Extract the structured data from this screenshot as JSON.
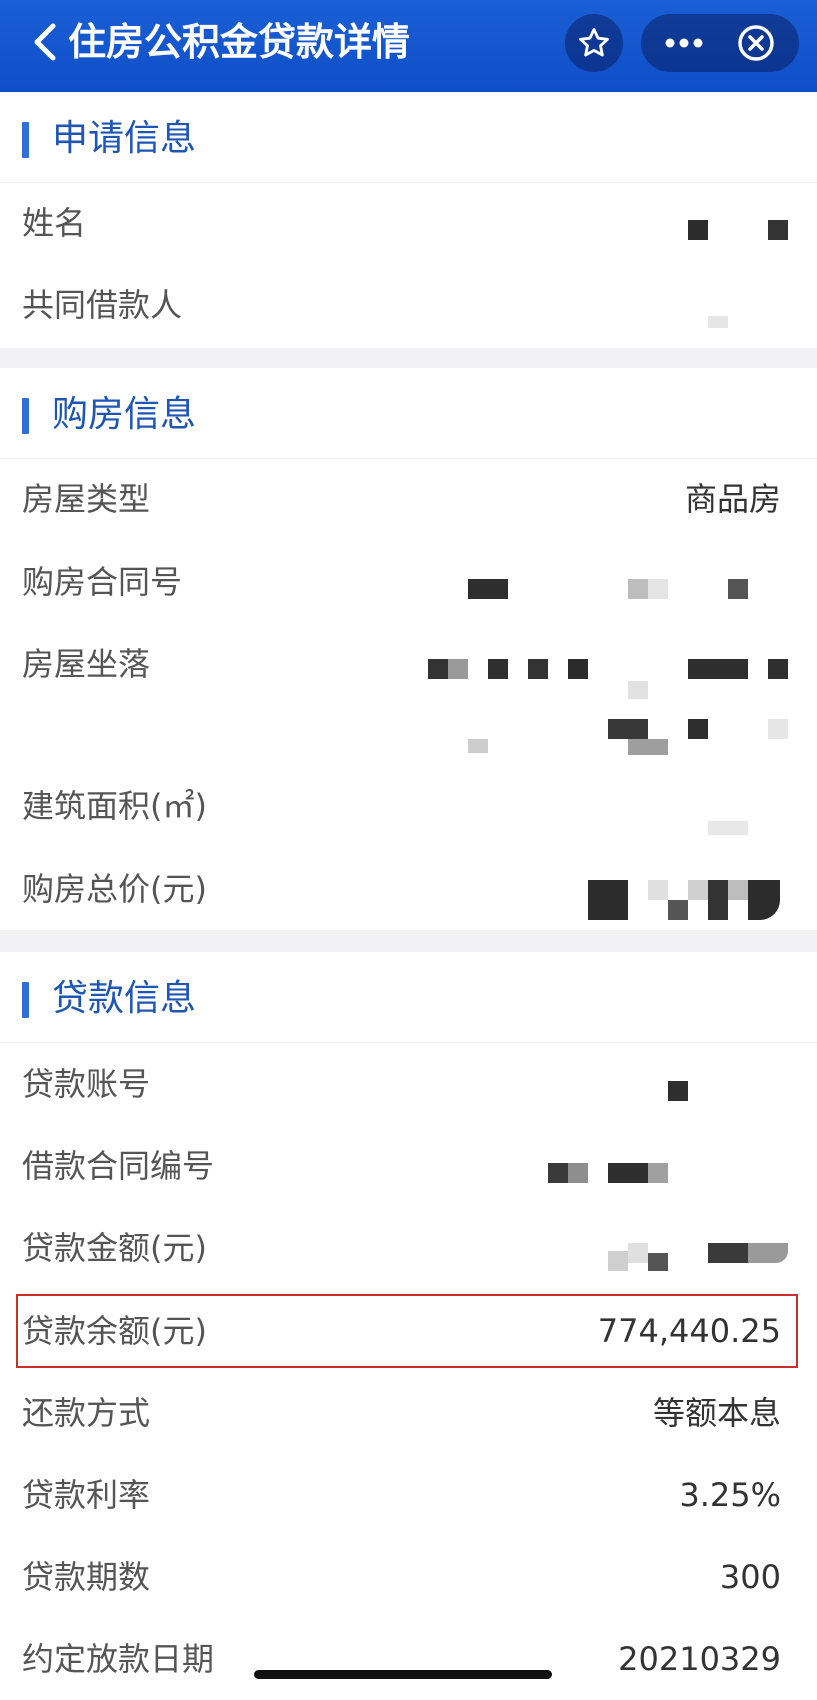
{
  "header": {
    "title": "住房公积金贷款详情",
    "back_icon": "chevron-left-icon",
    "star_icon": "star-icon",
    "more_icon": "more-dots-icon",
    "close_icon": "close-circle-icon",
    "colors": {
      "bar_start": "#1a5fd6",
      "bar_end": "#0f4ec6",
      "accent": "#2f6fd8",
      "section_title": "#1e56b5",
      "highlight": "#c9302c"
    }
  },
  "sections": {
    "apply": {
      "title": "申请信息",
      "name_label": "姓名",
      "coborrower_label": "共同借款人"
    },
    "purchase": {
      "title": "购房信息",
      "house_type_label": "房屋类型",
      "house_type_value": "商品房",
      "contract_no_label": "购房合同号",
      "location_label": "房屋坐落",
      "area_label": "建筑面积(㎡)",
      "total_price_label": "购房总价(元)"
    },
    "loan": {
      "title": "贷款信息",
      "account_label": "贷款账号",
      "contract_label": "借款合同编号",
      "amount_label": "贷款金额(元)",
      "balance_label": "贷款余额(元)",
      "balance_value": "774,440.25",
      "repay_method_label": "还款方式",
      "repay_method_value": "等额本息",
      "rate_label": "贷款利率",
      "rate_value": "3.25%",
      "term_label": "贷款期数",
      "term_value": "300",
      "date_label": "约定放款日期",
      "date_value": "20210329"
    }
  }
}
